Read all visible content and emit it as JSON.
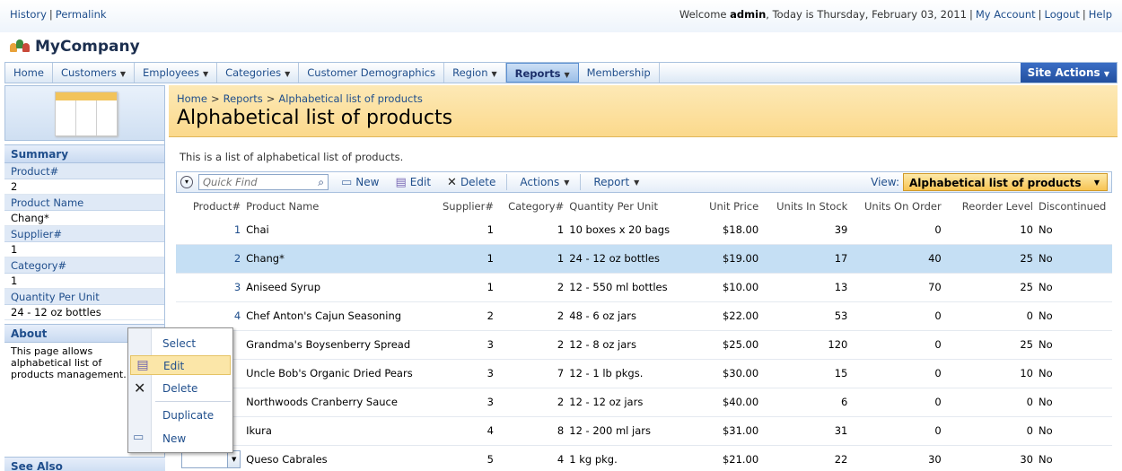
{
  "top": {
    "links": [
      "History",
      "Permalink"
    ],
    "welcome_prefix": "Welcome ",
    "user": "admin",
    "date_text": ", Today is Thursday, February 03, 2011",
    "account_links": [
      "My Account",
      "Logout",
      "Help"
    ]
  },
  "brand": {
    "name": "MyCompany"
  },
  "nav": {
    "items": [
      {
        "label": "Home",
        "has_menu": false
      },
      {
        "label": "Customers",
        "has_menu": true
      },
      {
        "label": "Employees",
        "has_menu": true
      },
      {
        "label": "Categories",
        "has_menu": true
      },
      {
        "label": "Customer Demographics",
        "has_menu": false
      },
      {
        "label": "Region",
        "has_menu": true
      },
      {
        "label": "Reports",
        "has_menu": true,
        "active": true
      },
      {
        "label": "Membership",
        "has_menu": false
      }
    ],
    "site_actions": "Site Actions"
  },
  "sidebar": {
    "summary_title": "Summary",
    "fields": [
      {
        "label": "Product#",
        "value": "2"
      },
      {
        "label": "Product Name",
        "value": "Chang*"
      },
      {
        "label": "Supplier#",
        "value": "1"
      },
      {
        "label": "Category#",
        "value": "1"
      },
      {
        "label": "Quantity Per Unit",
        "value": "24 - 12 oz bottles"
      }
    ],
    "about_title": "About",
    "about_text": "This page allows alphabetical list of products management.",
    "see_also_title": "See Also"
  },
  "page": {
    "breadcrumb": [
      "Home",
      "Reports",
      "Alphabetical list of products"
    ],
    "title": "Alphabetical list of products",
    "description": "This is a list of alphabetical list of products."
  },
  "toolbar": {
    "quick_find_placeholder": "Quick Find",
    "new_label": "New",
    "edit_label": "Edit",
    "delete_label": "Delete",
    "actions_label": "Actions",
    "report_label": "Report",
    "view_label": "View:",
    "view_value": "Alphabetical list of products"
  },
  "grid": {
    "columns": [
      "Product#",
      "Product Name",
      "Supplier#",
      "Category#",
      "Quantity Per Unit",
      "Unit Price",
      "Units In Stock",
      "Units On Order",
      "Reorder Level",
      "Discontinued"
    ],
    "rows": [
      [
        "1",
        "Chai",
        "1",
        "1",
        "10 boxes x 20 bags",
        "$18.00",
        "39",
        "0",
        "10",
        "No"
      ],
      [
        "2",
        "Chang*",
        "1",
        "1",
        "24 - 12 oz bottles",
        "$19.00",
        "17",
        "40",
        "25",
        "No"
      ],
      [
        "3",
        "Aniseed Syrup",
        "1",
        "2",
        "12 - 550 ml bottles",
        "$10.00",
        "13",
        "70",
        "25",
        "No"
      ],
      [
        "4",
        "Chef Anton's Cajun Seasoning",
        "2",
        "2",
        "48 - 6 oz jars",
        "$22.00",
        "53",
        "0",
        "0",
        "No"
      ],
      [
        "",
        "Grandma's Boysenberry Spread",
        "3",
        "2",
        "12 - 8 oz jars",
        "$25.00",
        "120",
        "0",
        "25",
        "No"
      ],
      [
        "",
        "Uncle Bob's Organic Dried Pears",
        "3",
        "7",
        "12 - 1 lb pkgs.",
        "$30.00",
        "15",
        "0",
        "10",
        "No"
      ],
      [
        "",
        "Northwoods Cranberry Sauce",
        "3",
        "2",
        "12 - 12 oz jars",
        "$40.00",
        "6",
        "0",
        "0",
        "No"
      ],
      [
        "",
        "Ikura",
        "4",
        "8",
        "12 - 200 ml jars",
        "$31.00",
        "31",
        "0",
        "0",
        "No"
      ],
      [
        "",
        "Queso Cabrales",
        "5",
        "4",
        "1 kg pkg.",
        "$21.00",
        "22",
        "30",
        "30",
        "No"
      ]
    ],
    "selected_row": 1
  },
  "context_menu": {
    "items": [
      "Select",
      "Edit",
      "Delete",
      "Duplicate",
      "New"
    ],
    "highlighted": "Edit"
  },
  "colors": {
    "accent": "#1f4e8c",
    "header_band": "#fbd98c",
    "selected_row": "#c5dff4",
    "site_actions": "#224f9e"
  }
}
